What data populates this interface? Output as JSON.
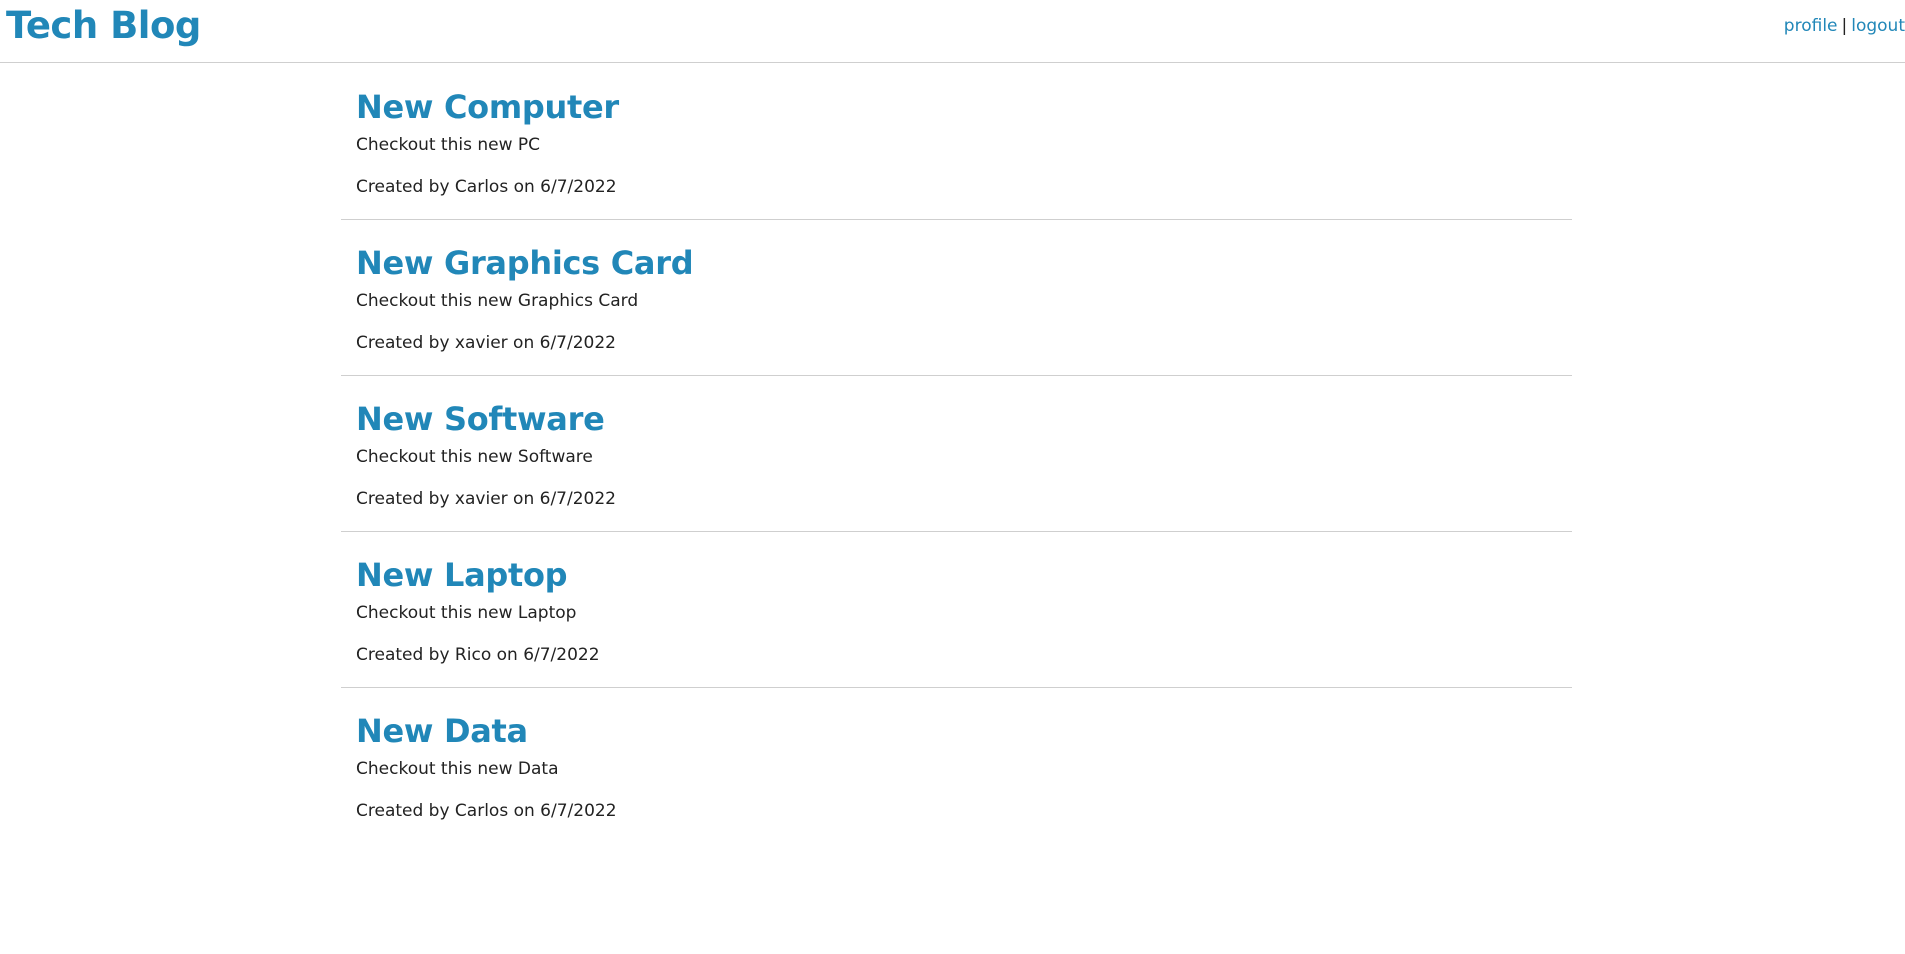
{
  "header": {
    "site_title": "Tech Blog",
    "nav": {
      "profile_label": "profile",
      "separator": "|",
      "logout_label": "logout"
    }
  },
  "posts": [
    {
      "title": "New Computer",
      "body": "Checkout this new PC",
      "meta": "Created by Carlos on 6/7/2022"
    },
    {
      "title": "New Graphics Card",
      "body": "Checkout this new Graphics Card",
      "meta": "Created by xavier on 6/7/2022"
    },
    {
      "title": "New Software",
      "body": "Checkout this new Software",
      "meta": "Created by xavier on 6/7/2022"
    },
    {
      "title": "New Laptop",
      "body": "Checkout this new Laptop",
      "meta": "Created by Rico on 6/7/2022"
    },
    {
      "title": "New Data",
      "body": "Checkout this new Data",
      "meta": "Created by Carlos on 6/7/2022"
    }
  ],
  "colors": {
    "accent": "#2187b8",
    "text": "#222222",
    "divider": "#cfcfcf"
  }
}
